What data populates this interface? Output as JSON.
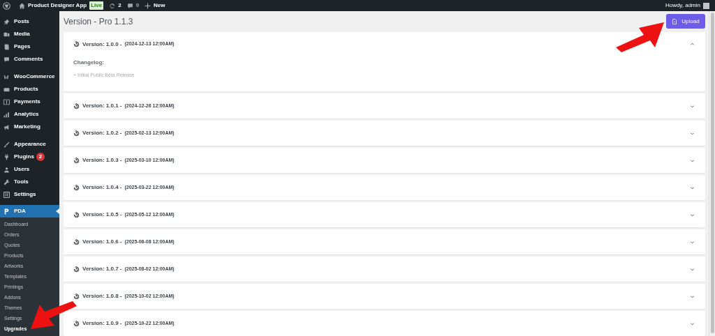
{
  "admin_bar": {
    "site_name": "Product Designer App",
    "live_badge": "Live",
    "updates": "2",
    "comments": "0",
    "new": "New",
    "greeting": "Howdy, admin"
  },
  "sidebar": {
    "groups": [
      [
        {
          "label": "Posts"
        },
        {
          "label": "Media"
        },
        {
          "label": "Pages"
        },
        {
          "label": "Comments"
        }
      ],
      [
        {
          "label": "WooCommerce"
        },
        {
          "label": "Products"
        },
        {
          "label": "Payments"
        },
        {
          "label": "Analytics"
        },
        {
          "label": "Marketing"
        }
      ],
      [
        {
          "label": "Appearance"
        },
        {
          "label": "Plugins",
          "badge": "2"
        },
        {
          "label": "Users"
        },
        {
          "label": "Tools"
        },
        {
          "label": "Settings"
        }
      ]
    ],
    "current": {
      "label": "PDA"
    },
    "submenu": [
      {
        "label": "Dashboard",
        "selected": false
      },
      {
        "label": "Orders",
        "selected": false
      },
      {
        "label": "Quotes",
        "selected": false
      },
      {
        "label": "Products",
        "selected": false
      },
      {
        "label": "Artworks",
        "selected": false
      },
      {
        "label": "Templates",
        "selected": false
      },
      {
        "label": "Printings",
        "selected": false
      },
      {
        "label": "Addons",
        "selected": false
      },
      {
        "label": "Themes",
        "selected": false
      },
      {
        "label": "Settings",
        "selected": false
      },
      {
        "label": "Upgrades",
        "selected": true
      }
    ]
  },
  "page": {
    "title": "Version - Pro 1.1.3",
    "upload_button": "Upload"
  },
  "versions": [
    {
      "version": "Version: 1.0.0 -",
      "date": "(2024-12-13 12:00AM)",
      "expanded": true,
      "changelog_title": "Changelog:",
      "changelog": [
        "+ Initial Public Beta Release"
      ]
    },
    {
      "version": "Version: 1.0.1 -",
      "date": "(2024-12-26 12:00AM)",
      "expanded": false
    },
    {
      "version": "Version: 1.0.2 -",
      "date": "(2025-02-13 12:00AM)",
      "expanded": false
    },
    {
      "version": "Version: 1.0.3 -",
      "date": "(2025-03-10 12:00AM)",
      "expanded": false
    },
    {
      "version": "Version: 1.0.4 -",
      "date": "(2025-03-22 12:00AM)",
      "expanded": false
    },
    {
      "version": "Version: 1.0.5 -",
      "date": "(2025-05-12 12:00AM)",
      "expanded": false
    },
    {
      "version": "Version: 1.0.6 -",
      "date": "(2025-06-08 12:00AM)",
      "expanded": false
    },
    {
      "version": "Version: 1.0.7 -",
      "date": "(2025-08-02 12:00AM)",
      "expanded": false
    },
    {
      "version": "Version: 1.0.8 -",
      "date": "(2025-10-02 12:00AM)",
      "expanded": false
    },
    {
      "version": "Version: 1.0.9 -",
      "date": "(2025-10-22 12:00AM)",
      "expanded": false
    }
  ]
}
